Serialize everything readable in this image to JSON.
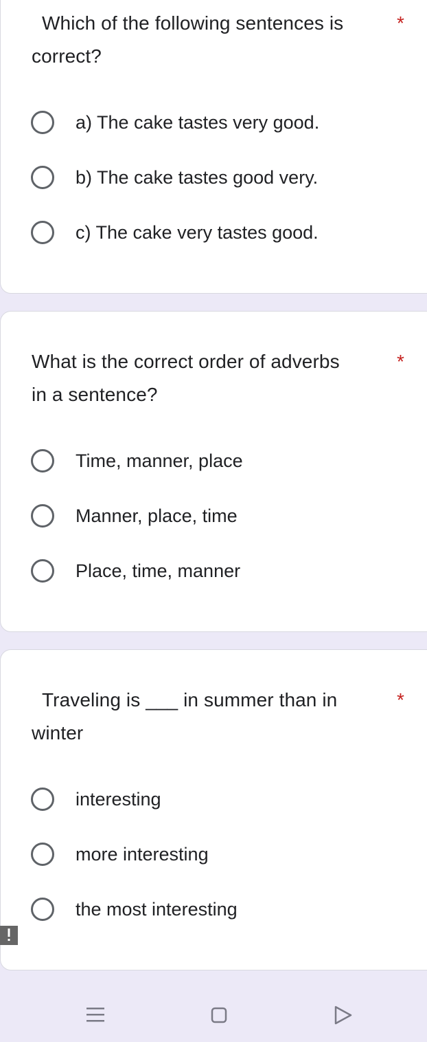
{
  "questions": [
    {
      "text_line1": "Which of the following sentences is",
      "text_line2": "correct?",
      "required_mark": "*",
      "options": [
        "a) The cake tastes very good.",
        "b) The cake tastes good very.",
        "c) The cake very tastes good."
      ]
    },
    {
      "text_line1": "What is the correct order of adverbs",
      "text_line2": "in a sentence?",
      "required_mark": "*",
      "options": [
        "Time, manner, place",
        "Manner, place, time",
        "Place, time, manner"
      ]
    },
    {
      "text_line1": "Traveling is ___ in summer than in",
      "text_line2": "winter",
      "required_mark": "*",
      "options": [
        "interesting",
        "more interesting",
        "the most interesting"
      ]
    }
  ],
  "colors": {
    "background": "#ece9f7",
    "card": "#ffffff",
    "required_asterisk": "#c5221f",
    "radio_border": "#5f6368",
    "nav_icon": "#7a7a86"
  },
  "icons": {
    "error_badge": "exclamation-icon",
    "nav_recent": "recent-apps-icon",
    "nav_home": "home-icon",
    "nav_back": "back-icon"
  }
}
